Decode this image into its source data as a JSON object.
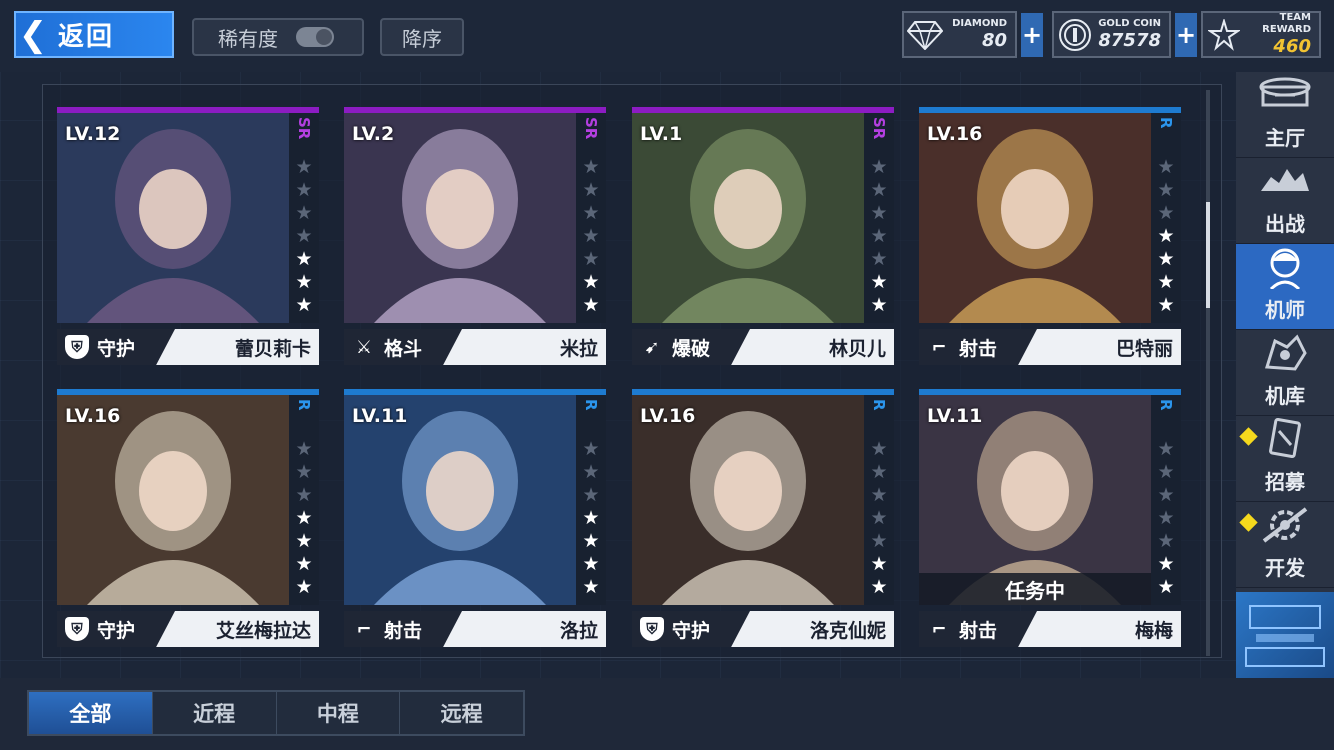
{
  "topbar": {
    "back_label": "返回",
    "sort_rarity_label": "稀有度",
    "sort_desc_label": "降序",
    "currencies": [
      {
        "icon": "diamond-icon",
        "label": "DIAMOND",
        "value": "80"
      },
      {
        "icon": "gold-coin-icon",
        "label": "GOLD COIN",
        "value": "87578"
      },
      {
        "icon": "team-reward-icon",
        "label": "TEAM REWARD",
        "value": "460"
      }
    ],
    "plus_label": "+"
  },
  "cards": [
    {
      "level": "LV.12",
      "rarity": "SR",
      "stars": 3,
      "max_stars": 7,
      "role": "守护",
      "role_icon": "shield-icon",
      "name": "蕾贝莉卡",
      "status": ""
    },
    {
      "level": "LV.2",
      "rarity": "SR",
      "stars": 2,
      "max_stars": 7,
      "role": "格斗",
      "role_icon": "crossed-swords-icon",
      "name": "米拉",
      "status": ""
    },
    {
      "level": "LV.1",
      "rarity": "SR",
      "stars": 2,
      "max_stars": 7,
      "role": "爆破",
      "role_icon": "bazooka-icon",
      "name": "林贝儿",
      "status": ""
    },
    {
      "level": "LV.16",
      "rarity": "R",
      "stars": 4,
      "max_stars": 7,
      "role": "射击",
      "role_icon": "rifle-icon",
      "name": "巴特丽",
      "status": ""
    },
    {
      "level": "LV.16",
      "rarity": "R",
      "stars": 4,
      "max_stars": 7,
      "role": "守护",
      "role_icon": "shield-icon",
      "name": "艾丝梅拉达",
      "status": ""
    },
    {
      "level": "LV.11",
      "rarity": "R",
      "stars": 4,
      "max_stars": 7,
      "role": "射击",
      "role_icon": "rifle-icon",
      "name": "洛拉",
      "status": ""
    },
    {
      "level": "LV.16",
      "rarity": "R",
      "stars": 2,
      "max_stars": 7,
      "role": "守护",
      "role_icon": "shield-icon",
      "name": "洛克仙妮",
      "status": ""
    },
    {
      "level": "LV.11",
      "rarity": "R",
      "stars": 2,
      "max_stars": 7,
      "role": "射击",
      "role_icon": "rifle-icon",
      "name": "梅梅",
      "status": "任务中"
    }
  ],
  "sidebar": {
    "items": [
      {
        "label": "主厅",
        "icon": "hall-icon",
        "active": false,
        "badge": false
      },
      {
        "label": "出战",
        "icon": "battle-icon",
        "active": false,
        "badge": false
      },
      {
        "label": "机师",
        "icon": "pilot-icon",
        "active": true,
        "badge": false
      },
      {
        "label": "机库",
        "icon": "hangar-icon",
        "active": false,
        "badge": false
      },
      {
        "label": "招募",
        "icon": "recruit-card-icon",
        "active": false,
        "badge": true
      },
      {
        "label": "开发",
        "icon": "develop-gear-icon",
        "active": false,
        "badge": true
      }
    ]
  },
  "tabs": [
    {
      "label": "全部",
      "active": true
    },
    {
      "label": "近程",
      "active": false
    },
    {
      "label": "中程",
      "active": false
    },
    {
      "label": "远程",
      "active": false
    }
  ],
  "colors": {
    "sr_accent": "#8c1cc2",
    "r_accent": "#1e7bd0",
    "active_blue": "#2c69c2",
    "team_reward_gold": "#f2c332",
    "badge_yellow": "#f5d91d"
  }
}
